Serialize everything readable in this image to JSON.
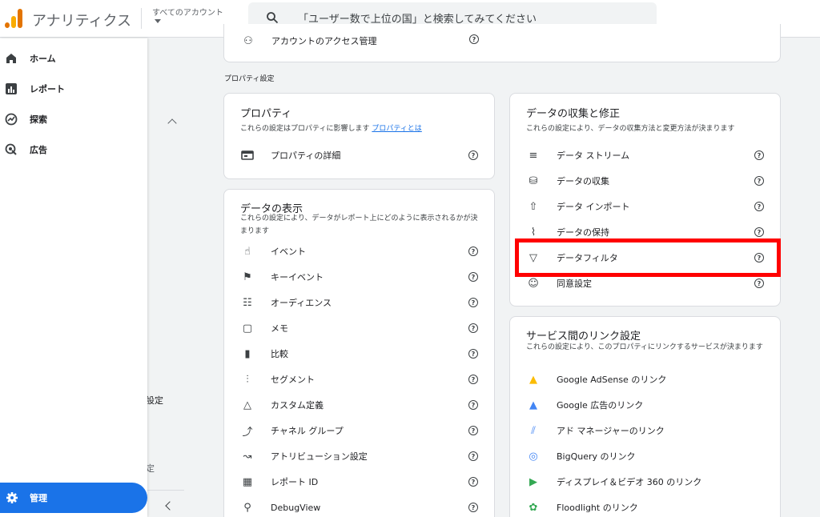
{
  "header": {
    "app_title": "アナリティクス",
    "account_label": "すべてのアカウント",
    "search_placeholder": "「ユーザー数で上位の国」と検索してみてください"
  },
  "sidebar": {
    "items": [
      {
        "label": "ホーム",
        "icon": "home-icon"
      },
      {
        "label": "レポート",
        "icon": "reports-icon"
      },
      {
        "label": "探索",
        "icon": "explore-icon"
      },
      {
        "label": "広告",
        "icon": "advertising-icon"
      }
    ],
    "admin_label": "管理",
    "partial_text_1": "設定",
    "partial_text_2": "定"
  },
  "top_card": {
    "row_label": "アカウントのアクセス管理"
  },
  "section_label": "プロパティ設定",
  "property_card": {
    "title": "プロパティ",
    "desc": "これらの設定はプロパティに影響します",
    "desc_link": "プロパティとは",
    "rows": [
      {
        "label": "プロパティの詳細",
        "icon": "property-details-icon"
      }
    ]
  },
  "display_card": {
    "title": "データの表示",
    "desc": "これらの設定により、データがレポート上にどのように表示されるかが決まります",
    "rows": [
      {
        "label": "イベント",
        "icon": "touch-icon"
      },
      {
        "label": "キーイベント",
        "icon": "flag-icon"
      },
      {
        "label": "オーディエンス",
        "icon": "audience-icon"
      },
      {
        "label": "メモ",
        "icon": "note-icon"
      },
      {
        "label": "比較",
        "icon": "compare-icon"
      },
      {
        "label": "セグメント",
        "icon": "segment-icon"
      },
      {
        "label": "カスタム定義",
        "icon": "shapes-icon"
      },
      {
        "label": "チャネル グループ",
        "icon": "merge-icon"
      },
      {
        "label": "アトリビューション設定",
        "icon": "route-icon"
      },
      {
        "label": "レポート ID",
        "icon": "report-id-icon"
      },
      {
        "label": "DebugView",
        "icon": "debug-icon"
      }
    ]
  },
  "collection_card": {
    "title": "データの収集と修正",
    "desc": "これらの設定により、データの収集方法と変更方法が決まります",
    "rows": [
      {
        "label": "データ ストリーム",
        "icon": "stream-icon"
      },
      {
        "label": "データの収集",
        "icon": "database-icon"
      },
      {
        "label": "データ インポート",
        "icon": "upload-icon"
      },
      {
        "label": "データの保持",
        "icon": "retention-icon"
      },
      {
        "label": "データフィルタ",
        "icon": "filter-icon"
      },
      {
        "label": "同意設定",
        "icon": "consent-icon"
      }
    ]
  },
  "links_card": {
    "title": "サービス間のリンク設定",
    "desc": "これらの設定により、このプロパティにリンクするサービスが決まります",
    "rows": [
      {
        "label": "Google AdSense のリンク",
        "icon": "adsense-icon"
      },
      {
        "label": "Google 広告のリンク",
        "icon": "google-ads-icon"
      },
      {
        "label": "アド マネージャーのリンク",
        "icon": "ad-manager-icon"
      },
      {
        "label": "BigQuery のリンク",
        "icon": "bigquery-icon"
      },
      {
        "label": "ディスプレイ＆ビデオ 360 のリンク",
        "icon": "dv360-icon"
      },
      {
        "label": "Floodlight のリンク",
        "icon": "floodlight-icon"
      }
    ]
  },
  "colors": {
    "accent": "#1a73e8",
    "highlight": "#ff0000",
    "logo_orange": "#f9ab00",
    "logo_dark": "#e37400"
  }
}
